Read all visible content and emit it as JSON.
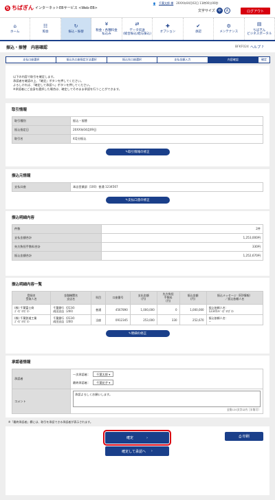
{
  "header": {
    "brand": "ちばぎん",
    "service": "インターネットEBサービス <Web-EB>",
    "user": "千葉太郎 様",
    "last_login": "20XX年04月02日 11時00分00秒",
    "font_size_label": "文字サイズ",
    "font_small": "中",
    "font_large": "大",
    "logout": "ログアウト"
  },
  "nav": [
    {
      "label": "ホーム",
      "icon": "⌂"
    },
    {
      "label": "照会",
      "icon": "☷"
    },
    {
      "label": "振込・振替",
      "icon": "↻"
    },
    {
      "label": "税金・各種料金\n払込み",
      "icon": "¥"
    },
    {
      "label": "データ伝送\n(総合振込/給与振込)",
      "icon": "⇄"
    },
    {
      "label": "オプション",
      "icon": "✚"
    },
    {
      "label": "承認",
      "icon": "✔"
    },
    {
      "label": "メンテナンス",
      "icon": "⚙"
    },
    {
      "label": "ちばぎん\nビジネスポータル",
      "icon": "▤"
    }
  ],
  "page": {
    "title": "振込・振替　内容確認",
    "code": "BFKF024",
    "help": "ヘルプ ?"
  },
  "steps": [
    "支払口座選択",
    "振込先口座指定方法選択",
    "振込先口座選択",
    "支払金額入力",
    "内容確認",
    "確定"
  ],
  "intro": [
    "以下の内容で取引を確定します。",
    "承認者を確認の上、「確定」ボタンを押してください。",
    "よろしければ、「確定して承認へ」ボタンを押してください。",
    "※承認者にご自身を選択した場合は、確定してそのまま承認を行うことができます。"
  ],
  "tx_info": {
    "title": "取引情報",
    "rows": [
      {
        "k": "取引種別",
        "v": "振込・振替"
      },
      {
        "k": "振込指定日",
        "v": "20XX年04月09日"
      },
      {
        "k": "取引名",
        "v": "4月分振込"
      }
    ],
    "button": "取引情報の修正"
  },
  "src_info": {
    "title": "振込元情報",
    "rows": [
      {
        "k": "支払口座",
        "v": "本店営業部（100）普通 1234567"
      }
    ],
    "button": "支払口座の修正"
  },
  "detail": {
    "title": "振込明細内容",
    "rows": [
      {
        "k": "件数",
        "v": "2件"
      },
      {
        "k": "支払金額合計",
        "v": "1,253,000円"
      },
      {
        "k": "先方負担手数料合計",
        "v": "330円"
      },
      {
        "k": "振込金額合計",
        "v": "1,252,670円"
      }
    ]
  },
  "list": {
    "title": "振込明細内容一覧",
    "headers": [
      "登録名\n受取人名",
      "金融機関名\n支店名",
      "科目",
      "口座番号",
      "支払金額\n(円)",
      "先方負担\n手数料\n(円)",
      "振込金額\n(円)",
      "振込メッセージ（EDI情報）\n／振込依頼人名"
    ],
    "rows": [
      [
        "(株) 千葉富士商\nｽﾞｲｶﾞﾖｳｶﾞﾈﾝ",
        "千葉銀行（0134）\n成田支店（200）",
        "普通",
        "4567890",
        "1,000,000",
        "0",
        "1,000,000",
        "振込依頼人名：\n12345ﾁﾊﾞｲｶﾞﾖｳｶﾞﾈﾝ"
      ],
      [
        "(株) 千葉鉄道工業\nｽﾞｲｶﾞﾖｳｶﾞﾈﾝ",
        "千葉銀行（0134）\n成田支店（200）",
        "当座",
        "0912345",
        "253,000",
        "330",
        "252,670",
        "振込依頼人名：\n−"
      ]
    ],
    "button": "明細の修正"
  },
  "approver": {
    "title": "承認者情報",
    "label": "承認者",
    "first_label": "一次承認者：",
    "first": "千葉太郎",
    "final_label": "最終承認者：",
    "final": "千葉花子",
    "comment_label": "コメント",
    "comment": "承認よろしくお願いします。",
    "limit": "全角120文字以内［半角可］"
  },
  "footnote": "※「最終承認者」欄には、取引を承認できる承認者が表示されます。",
  "actions": {
    "confirm": "確定",
    "confirm_approve": "確定して承認へ",
    "print": "印刷"
  }
}
